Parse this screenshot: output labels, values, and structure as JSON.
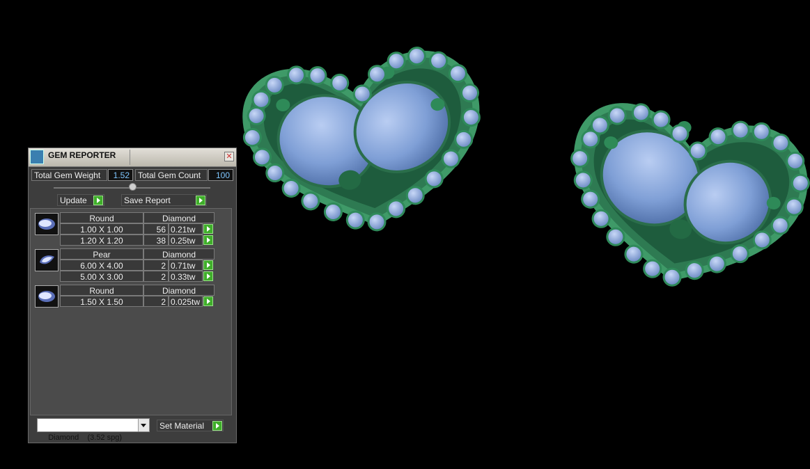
{
  "panel": {
    "title": "GEM REPORTER",
    "close_label": "✕",
    "total_weight_label": "Total Gem Weight",
    "total_weight_value": "1.52",
    "total_count_label": "Total Gem Count",
    "total_count_value": "100",
    "update_label": "Update",
    "save_report_label": "Save Report",
    "groups": [
      {
        "shape": "Round",
        "material": "Diamond",
        "icon": "round-gem-icon",
        "rows": [
          {
            "size": "1.00 X 1.00",
            "count": "56",
            "weight": "0.21tw"
          },
          {
            "size": "1.20 X 1.20",
            "count": "38",
            "weight": "0.25tw"
          }
        ]
      },
      {
        "shape": "Pear",
        "material": "Diamond",
        "icon": "pear-gem-icon",
        "rows": [
          {
            "size": "6.00 X 4.00",
            "count": "2",
            "weight": "0.71tw"
          },
          {
            "size": "5.00 X 3.00",
            "count": "2",
            "weight": "0.33tw"
          }
        ]
      },
      {
        "shape": "Round",
        "material": "Diamond",
        "icon": "round-gem-icon",
        "rows": [
          {
            "size": "1.50 X 1.50",
            "count": "2",
            "weight": "0.025tw"
          }
        ]
      }
    ],
    "material_select": "Diamond    (3.52 spg)",
    "set_material_label": "Set Material"
  },
  "colors": {
    "background": "#000000",
    "metal": "#2e7a52",
    "gem": "#7f9fd6",
    "accent_green": "#3fae2a",
    "value_text": "#7ec6ff"
  }
}
